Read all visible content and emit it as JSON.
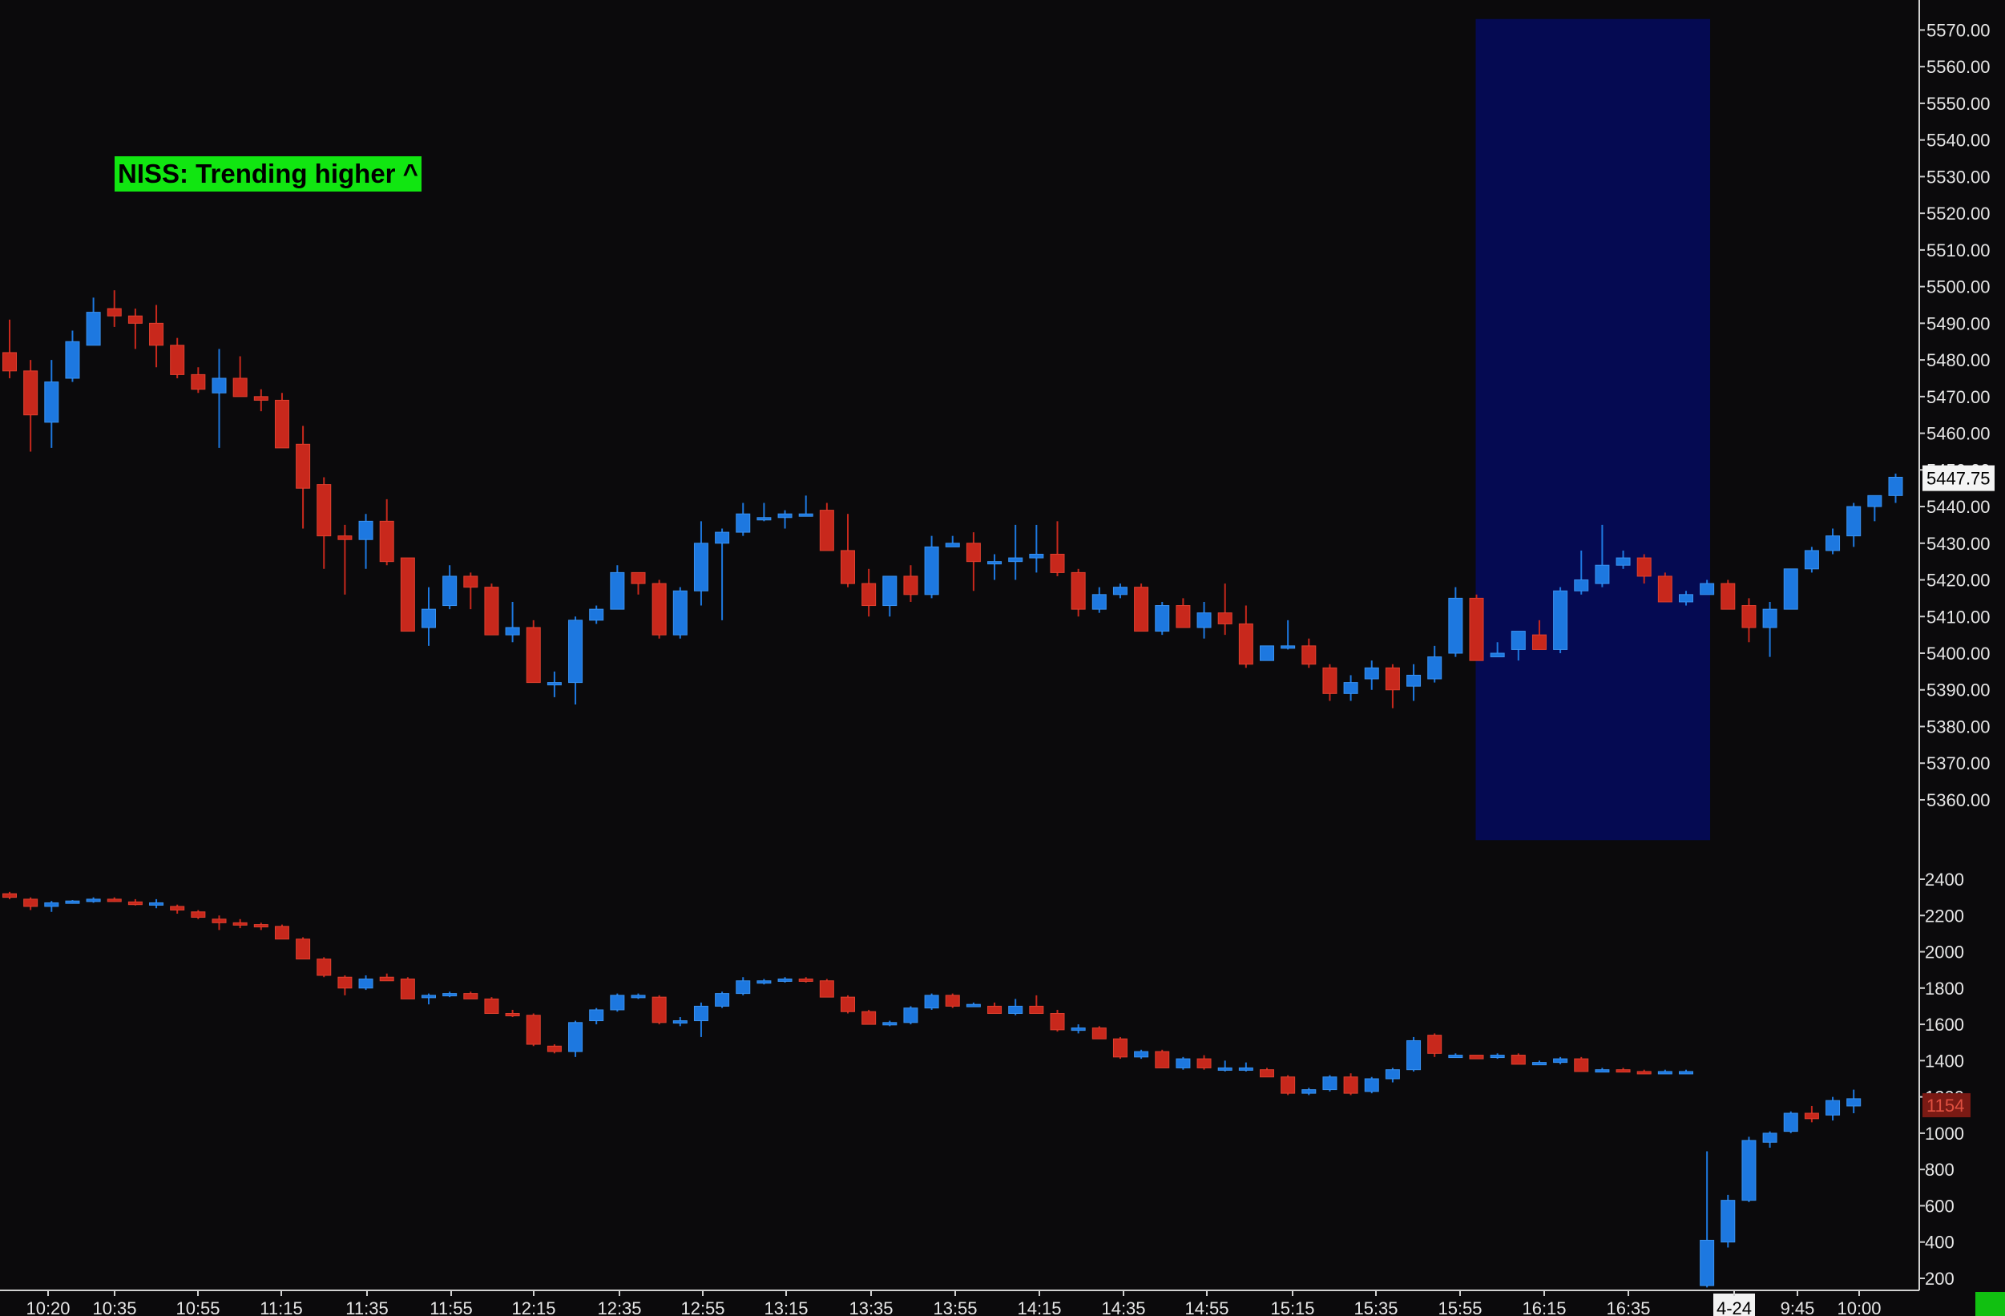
{
  "colors": {
    "background": "#0b0a0c",
    "up": "#1d78e0",
    "down": "#c8281c",
    "highlight": "#050a52",
    "text": "#e6e6e6",
    "banner": "#11e611"
  },
  "banner": {
    "text": "NISS: Trending higher ^"
  },
  "chart_data": [
    {
      "type": "candlestick",
      "title": "",
      "price_axis": {
        "range": [
          5346,
          5576
        ],
        "ticks": [
          "5570.00",
          "5560.00",
          "5550.00",
          "5540.00",
          "5530.00",
          "5520.00",
          "5510.00",
          "5500.00",
          "5490.00",
          "5480.00",
          "5470.00",
          "5460.00",
          "5450.00",
          "5440.00",
          "5430.00",
          "5420.00",
          "5410.00",
          "5400.00",
          "5390.00",
          "5380.00",
          "5370.00",
          "5360.00"
        ],
        "last_price_label": "5447.75"
      },
      "time_axis": {
        "labels": [
          "10:20",
          "10:35",
          "10:55",
          "11:15",
          "11:35",
          "11:55",
          "12:15",
          "12:35",
          "12:55",
          "13:15",
          "13:35",
          "13:55",
          "14:15",
          "14:35",
          "14:55",
          "15:15",
          "15:35",
          "15:55",
          "16:15",
          "16:35",
          "4-24",
          "9:45",
          "10:00"
        ]
      },
      "highlight_session": {
        "from_bar": 70,
        "to_bar": 81,
        "price_range": [
          5349,
          5573
        ]
      },
      "candles": [
        [
          5482,
          5491,
          5475,
          5477
        ],
        [
          5477,
          5480,
          5455,
          5465
        ],
        [
          5463,
          5480,
          5456,
          5474
        ],
        [
          5475,
          5488,
          5474,
          5485
        ],
        [
          5484,
          5497,
          5484,
          5493
        ],
        [
          5494,
          5499,
          5489,
          5492
        ],
        [
          5492,
          5494,
          5483,
          5490
        ],
        [
          5490,
          5495,
          5478,
          5484
        ],
        [
          5484,
          5486,
          5475,
          5476
        ],
        [
          5476,
          5478,
          5471,
          5472
        ],
        [
          5471,
          5483,
          5456,
          5475
        ],
        [
          5475,
          5481,
          5471,
          5470
        ],
        [
          5470,
          5472,
          5466,
          5469
        ],
        [
          5469,
          5471,
          5456,
          5456
        ],
        [
          5457,
          5462,
          5434,
          5445
        ],
        [
          5446,
          5448,
          5423,
          5432
        ],
        [
          5432,
          5435,
          5416,
          5431
        ],
        [
          5431,
          5438,
          5423,
          5436
        ],
        [
          5436,
          5442,
          5424,
          5425
        ],
        [
          5426,
          5426,
          5407,
          5406
        ],
        [
          5407,
          5418,
          5402,
          5412
        ],
        [
          5413,
          5424,
          5412,
          5421
        ],
        [
          5421,
          5422,
          5412,
          5418
        ],
        [
          5418,
          5419,
          5405,
          5405
        ],
        [
          5405,
          5414,
          5403,
          5407
        ],
        [
          5407,
          5409,
          5392,
          5392
        ],
        [
          5392,
          5395,
          5388,
          5392
        ],
        [
          5392,
          5410,
          5386,
          5409
        ],
        [
          5409,
          5413,
          5408,
          5412
        ],
        [
          5412,
          5424,
          5412,
          5422
        ],
        [
          5422,
          5422,
          5416,
          5419
        ],
        [
          5419,
          5420,
          5404,
          5405
        ],
        [
          5405,
          5418,
          5404,
          5417
        ],
        [
          5417,
          5436,
          5413,
          5430
        ],
        [
          5430,
          5434,
          5409,
          5433
        ],
        [
          5433,
          5441,
          5432,
          5438
        ],
        [
          5437,
          5441,
          5436,
          5437
        ],
        [
          5437,
          5439,
          5434,
          5438
        ],
        [
          5438,
          5443,
          5438,
          5438
        ],
        [
          5439,
          5441,
          5428,
          5428
        ],
        [
          5428,
          5438,
          5418,
          5419
        ],
        [
          5419,
          5423,
          5410,
          5413
        ],
        [
          5413,
          5421,
          5410,
          5421
        ],
        [
          5421,
          5424,
          5414,
          5416
        ],
        [
          5416,
          5432,
          5415,
          5429
        ],
        [
          5429,
          5432,
          5429,
          5430
        ],
        [
          5430,
          5433,
          5417,
          5425
        ],
        [
          5425,
          5427,
          5420,
          5425
        ],
        [
          5425,
          5435,
          5420,
          5426
        ],
        [
          5426,
          5435,
          5422,
          5427
        ],
        [
          5427,
          5436,
          5421,
          5422
        ],
        [
          5422,
          5423,
          5410,
          5412
        ],
        [
          5412,
          5418,
          5411,
          5416
        ],
        [
          5416,
          5419,
          5415,
          5418
        ],
        [
          5418,
          5419,
          5406,
          5406
        ],
        [
          5406,
          5414,
          5405,
          5413
        ],
        [
          5413,
          5415,
          5408,
          5407
        ],
        [
          5407,
          5414,
          5404,
          5411
        ],
        [
          5411,
          5419,
          5405,
          5408
        ],
        [
          5408,
          5413,
          5396,
          5397
        ],
        [
          5398,
          5402,
          5398,
          5402
        ],
        [
          5402,
          5409,
          5401,
          5402
        ],
        [
          5402,
          5404,
          5396,
          5397
        ],
        [
          5396,
          5397,
          5387,
          5389
        ],
        [
          5389,
          5394,
          5387,
          5392
        ],
        [
          5393,
          5398,
          5390,
          5396
        ],
        [
          5396,
          5397,
          5385,
          5390
        ],
        [
          5391,
          5397,
          5387,
          5394
        ],
        [
          5393,
          5402,
          5392,
          5399
        ],
        [
          5400,
          5418,
          5399,
          5415
        ],
        [
          5415,
          5416,
          5398,
          5398
        ],
        [
          5399,
          5403,
          5399,
          5400
        ],
        [
          5401,
          5406,
          5398,
          5406
        ],
        [
          5405,
          5409,
          5403,
          5401
        ],
        [
          5401,
          5418,
          5400,
          5417
        ],
        [
          5417,
          5428,
          5416,
          5420
        ],
        [
          5419,
          5435,
          5418,
          5424
        ],
        [
          5424,
          5428,
          5423,
          5426
        ],
        [
          5426,
          5427,
          5419,
          5421
        ],
        [
          5421,
          5422,
          5414,
          5414
        ],
        [
          5414,
          5417,
          5413,
          5416
        ],
        [
          5416,
          5420,
          5416,
          5419
        ],
        [
          5419,
          5420,
          5412,
          5412
        ],
        [
          5413,
          5415,
          5403,
          5407
        ],
        [
          5407,
          5414,
          5399,
          5412
        ],
        [
          5412,
          5423,
          5412,
          5423
        ],
        [
          5423,
          5429,
          5422,
          5428
        ],
        [
          5428,
          5434,
          5427,
          5432
        ],
        [
          5432,
          5441,
          5429,
          5440
        ],
        [
          5440,
          5443,
          5436,
          5443
        ],
        [
          5443,
          5449,
          5441,
          5448
        ]
      ]
    },
    {
      "type": "candlestick",
      "title": "",
      "value_axis": {
        "range": [
          150,
          2520
        ],
        "ticks": [
          "2400",
          "2200",
          "2000",
          "1800",
          "1600",
          "1400",
          "1200",
          "1000",
          "800",
          "600",
          "400",
          "200"
        ],
        "last_value_label": "1154"
      },
      "candles": [
        [
          2320,
          2330,
          2290,
          2300
        ],
        [
          2290,
          2300,
          2230,
          2250
        ],
        [
          2250,
          2280,
          2220,
          2270
        ],
        [
          2270,
          2285,
          2265,
          2280
        ],
        [
          2280,
          2300,
          2270,
          2290
        ],
        [
          2290,
          2300,
          2275,
          2280
        ],
        [
          2275,
          2290,
          2255,
          2260
        ],
        [
          2260,
          2290,
          2240,
          2270
        ],
        [
          2250,
          2260,
          2210,
          2230
        ],
        [
          2220,
          2230,
          2180,
          2190
        ],
        [
          2180,
          2200,
          2120,
          2160
        ],
        [
          2160,
          2180,
          2130,
          2150
        ],
        [
          2150,
          2160,
          2120,
          2140
        ],
        [
          2140,
          2150,
          2070,
          2070
        ],
        [
          2070,
          2080,
          1970,
          1960
        ],
        [
          1960,
          1970,
          1860,
          1870
        ],
        [
          1860,
          1870,
          1760,
          1800
        ],
        [
          1800,
          1870,
          1790,
          1850
        ],
        [
          1860,
          1880,
          1840,
          1840
        ],
        [
          1850,
          1860,
          1740,
          1740
        ],
        [
          1750,
          1770,
          1710,
          1760
        ],
        [
          1760,
          1780,
          1750,
          1770
        ],
        [
          1770,
          1780,
          1740,
          1740
        ],
        [
          1740,
          1750,
          1660,
          1660
        ],
        [
          1660,
          1680,
          1640,
          1650
        ],
        [
          1650,
          1660,
          1480,
          1490
        ],
        [
          1480,
          1490,
          1440,
          1450
        ],
        [
          1450,
          1620,
          1420,
          1610
        ],
        [
          1620,
          1690,
          1600,
          1680
        ],
        [
          1680,
          1770,
          1670,
          1760
        ],
        [
          1750,
          1770,
          1740,
          1760
        ],
        [
          1750,
          1760,
          1600,
          1610
        ],
        [
          1610,
          1640,
          1590,
          1620
        ],
        [
          1620,
          1720,
          1530,
          1700
        ],
        [
          1700,
          1780,
          1690,
          1770
        ],
        [
          1770,
          1860,
          1760,
          1840
        ],
        [
          1830,
          1850,
          1820,
          1840
        ],
        [
          1840,
          1860,
          1830,
          1850
        ],
        [
          1850,
          1860,
          1830,
          1840
        ],
        [
          1840,
          1850,
          1750,
          1750
        ],
        [
          1750,
          1760,
          1660,
          1670
        ],
        [
          1670,
          1680,
          1600,
          1600
        ],
        [
          1600,
          1620,
          1590,
          1610
        ],
        [
          1610,
          1700,
          1600,
          1690
        ],
        [
          1690,
          1770,
          1680,
          1760
        ],
        [
          1760,
          1770,
          1690,
          1700
        ],
        [
          1700,
          1720,
          1700,
          1710
        ],
        [
          1700,
          1720,
          1660,
          1660
        ],
        [
          1660,
          1740,
          1650,
          1700
        ],
        [
          1700,
          1760,
          1660,
          1660
        ],
        [
          1660,
          1680,
          1560,
          1570
        ],
        [
          1570,
          1600,
          1550,
          1580
        ],
        [
          1580,
          1590,
          1520,
          1520
        ],
        [
          1520,
          1530,
          1410,
          1420
        ],
        [
          1420,
          1460,
          1410,
          1450
        ],
        [
          1450,
          1460,
          1360,
          1360
        ],
        [
          1360,
          1420,
          1350,
          1410
        ],
        [
          1410,
          1430,
          1350,
          1360
        ],
        [
          1360,
          1400,
          1340,
          1360
        ],
        [
          1360,
          1390,
          1340,
          1360
        ],
        [
          1350,
          1360,
          1310,
          1310
        ],
        [
          1310,
          1320,
          1210,
          1220
        ],
        [
          1220,
          1250,
          1210,
          1240
        ],
        [
          1240,
          1320,
          1230,
          1310
        ],
        [
          1310,
          1330,
          1210,
          1220
        ],
        [
          1230,
          1310,
          1220,
          1300
        ],
        [
          1300,
          1360,
          1280,
          1350
        ],
        [
          1350,
          1530,
          1340,
          1510
        ],
        [
          1540,
          1550,
          1420,
          1440
        ],
        [
          1430,
          1440,
          1420,
          1430
        ],
        [
          1430,
          1430,
          1410,
          1410
        ],
        [
          1420,
          1440,
          1410,
          1430
        ],
        [
          1430,
          1440,
          1380,
          1380
        ],
        [
          1380,
          1400,
          1380,
          1390
        ],
        [
          1390,
          1420,
          1380,
          1410
        ],
        [
          1410,
          1420,
          1340,
          1340
        ],
        [
          1350,
          1360,
          1350,
          1350
        ],
        [
          1350,
          1360,
          1340,
          1340
        ],
        [
          1340,
          1350,
          1330,
          1330
        ],
        [
          1330,
          1350,
          1330,
          1340
        ],
        [
          1340,
          1350,
          1330,
          1340
        ],
        [
          160,
          900,
          150,
          410
        ],
        [
          400,
          660,
          370,
          630
        ],
        [
          630,
          980,
          620,
          960
        ],
        [
          950,
          1010,
          920,
          1000
        ],
        [
          1010,
          1120,
          1000,
          1110
        ],
        [
          1110,
          1150,
          1060,
          1080
        ],
        [
          1100,
          1200,
          1070,
          1180
        ],
        [
          1150,
          1240,
          1110,
          1190
        ]
      ]
    }
  ]
}
